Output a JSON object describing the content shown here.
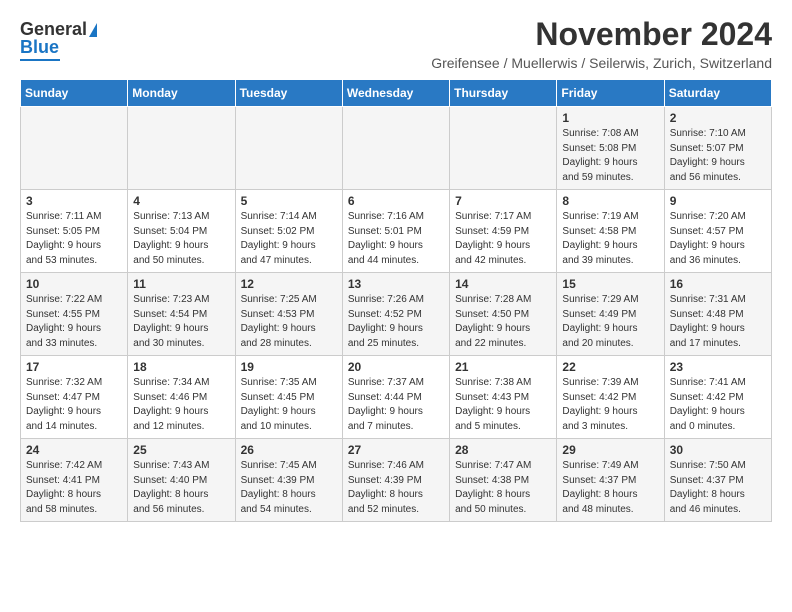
{
  "header": {
    "logo_line1": "General",
    "logo_line2": "Blue",
    "month": "November 2024",
    "location": "Greifensee / Muellerwis / Seilerwis, Zurich, Switzerland"
  },
  "weekdays": [
    "Sunday",
    "Monday",
    "Tuesday",
    "Wednesday",
    "Thursday",
    "Friday",
    "Saturday"
  ],
  "weeks": [
    [
      {
        "day": "",
        "info": ""
      },
      {
        "day": "",
        "info": ""
      },
      {
        "day": "",
        "info": ""
      },
      {
        "day": "",
        "info": ""
      },
      {
        "day": "",
        "info": ""
      },
      {
        "day": "1",
        "info": "Sunrise: 7:08 AM\nSunset: 5:08 PM\nDaylight: 9 hours\nand 59 minutes."
      },
      {
        "day": "2",
        "info": "Sunrise: 7:10 AM\nSunset: 5:07 PM\nDaylight: 9 hours\nand 56 minutes."
      }
    ],
    [
      {
        "day": "3",
        "info": "Sunrise: 7:11 AM\nSunset: 5:05 PM\nDaylight: 9 hours\nand 53 minutes."
      },
      {
        "day": "4",
        "info": "Sunrise: 7:13 AM\nSunset: 5:04 PM\nDaylight: 9 hours\nand 50 minutes."
      },
      {
        "day": "5",
        "info": "Sunrise: 7:14 AM\nSunset: 5:02 PM\nDaylight: 9 hours\nand 47 minutes."
      },
      {
        "day": "6",
        "info": "Sunrise: 7:16 AM\nSunset: 5:01 PM\nDaylight: 9 hours\nand 44 minutes."
      },
      {
        "day": "7",
        "info": "Sunrise: 7:17 AM\nSunset: 4:59 PM\nDaylight: 9 hours\nand 42 minutes."
      },
      {
        "day": "8",
        "info": "Sunrise: 7:19 AM\nSunset: 4:58 PM\nDaylight: 9 hours\nand 39 minutes."
      },
      {
        "day": "9",
        "info": "Sunrise: 7:20 AM\nSunset: 4:57 PM\nDaylight: 9 hours\nand 36 minutes."
      }
    ],
    [
      {
        "day": "10",
        "info": "Sunrise: 7:22 AM\nSunset: 4:55 PM\nDaylight: 9 hours\nand 33 minutes."
      },
      {
        "day": "11",
        "info": "Sunrise: 7:23 AM\nSunset: 4:54 PM\nDaylight: 9 hours\nand 30 minutes."
      },
      {
        "day": "12",
        "info": "Sunrise: 7:25 AM\nSunset: 4:53 PM\nDaylight: 9 hours\nand 28 minutes."
      },
      {
        "day": "13",
        "info": "Sunrise: 7:26 AM\nSunset: 4:52 PM\nDaylight: 9 hours\nand 25 minutes."
      },
      {
        "day": "14",
        "info": "Sunrise: 7:28 AM\nSunset: 4:50 PM\nDaylight: 9 hours\nand 22 minutes."
      },
      {
        "day": "15",
        "info": "Sunrise: 7:29 AM\nSunset: 4:49 PM\nDaylight: 9 hours\nand 20 minutes."
      },
      {
        "day": "16",
        "info": "Sunrise: 7:31 AM\nSunset: 4:48 PM\nDaylight: 9 hours\nand 17 minutes."
      }
    ],
    [
      {
        "day": "17",
        "info": "Sunrise: 7:32 AM\nSunset: 4:47 PM\nDaylight: 9 hours\nand 14 minutes."
      },
      {
        "day": "18",
        "info": "Sunrise: 7:34 AM\nSunset: 4:46 PM\nDaylight: 9 hours\nand 12 minutes."
      },
      {
        "day": "19",
        "info": "Sunrise: 7:35 AM\nSunset: 4:45 PM\nDaylight: 9 hours\nand 10 minutes."
      },
      {
        "day": "20",
        "info": "Sunrise: 7:37 AM\nSunset: 4:44 PM\nDaylight: 9 hours\nand 7 minutes."
      },
      {
        "day": "21",
        "info": "Sunrise: 7:38 AM\nSunset: 4:43 PM\nDaylight: 9 hours\nand 5 minutes."
      },
      {
        "day": "22",
        "info": "Sunrise: 7:39 AM\nSunset: 4:42 PM\nDaylight: 9 hours\nand 3 minutes."
      },
      {
        "day": "23",
        "info": "Sunrise: 7:41 AM\nSunset: 4:42 PM\nDaylight: 9 hours\nand 0 minutes."
      }
    ],
    [
      {
        "day": "24",
        "info": "Sunrise: 7:42 AM\nSunset: 4:41 PM\nDaylight: 8 hours\nand 58 minutes."
      },
      {
        "day": "25",
        "info": "Sunrise: 7:43 AM\nSunset: 4:40 PM\nDaylight: 8 hours\nand 56 minutes."
      },
      {
        "day": "26",
        "info": "Sunrise: 7:45 AM\nSunset: 4:39 PM\nDaylight: 8 hours\nand 54 minutes."
      },
      {
        "day": "27",
        "info": "Sunrise: 7:46 AM\nSunset: 4:39 PM\nDaylight: 8 hours\nand 52 minutes."
      },
      {
        "day": "28",
        "info": "Sunrise: 7:47 AM\nSunset: 4:38 PM\nDaylight: 8 hours\nand 50 minutes."
      },
      {
        "day": "29",
        "info": "Sunrise: 7:49 AM\nSunset: 4:37 PM\nDaylight: 8 hours\nand 48 minutes."
      },
      {
        "day": "30",
        "info": "Sunrise: 7:50 AM\nSunset: 4:37 PM\nDaylight: 8 hours\nand 46 minutes."
      }
    ]
  ]
}
